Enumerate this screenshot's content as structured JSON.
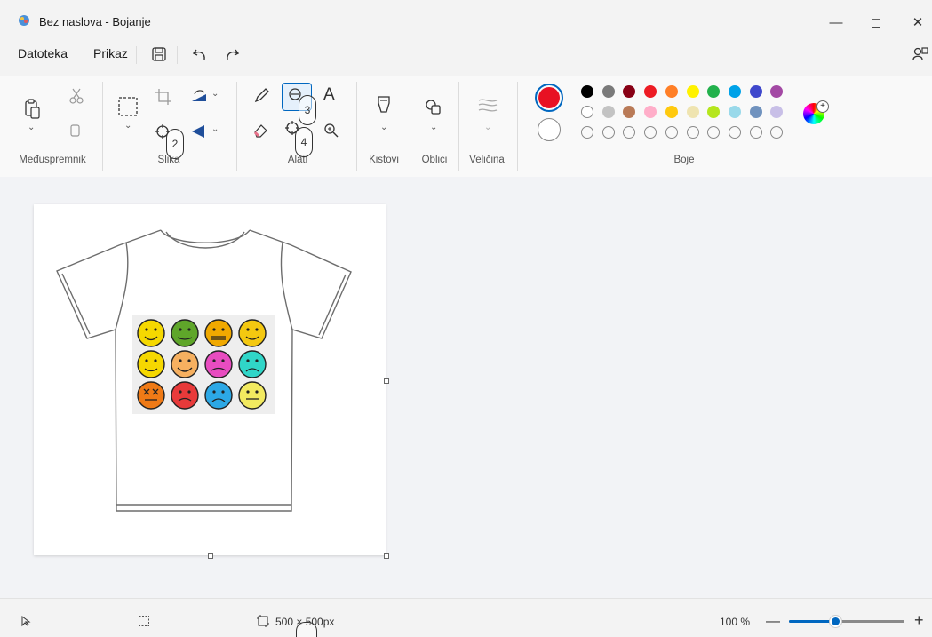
{
  "window": {
    "title": "Bez naslova - Bojanje"
  },
  "menu": {
    "file": "Datoteka",
    "view": "Prikaz"
  },
  "ribbon": {
    "groups": {
      "clipboard": "Međuspremnik",
      "image": "Slika",
      "tools": "Alati",
      "brushes": "Kistovi",
      "shapes": "Oblici",
      "size": "Veličina",
      "colors": "Boje"
    },
    "primary_color": "#e81123",
    "palette_row1": [
      "#000000",
      "#7a7a7a",
      "#880015",
      "#ed1c24",
      "#ff7f27",
      "#fff200",
      "#22b14c",
      "#00a2e8",
      "#3f48cc",
      "#a349a4"
    ],
    "palette_row2": [
      "#ffffff",
      "#c3c3c3",
      "#b97a57",
      "#ffaec9",
      "#ffc90e",
      "#efe4b0",
      "#b5e61d",
      "#99d9ea",
      "#7092be",
      "#c8bfe7"
    ],
    "palette_row3": [
      "",
      "",
      "",
      "",
      "",
      "",
      "",
      "",
      "",
      ""
    ]
  },
  "callouts": {
    "c2": "2",
    "c3": "3",
    "c4": "4"
  },
  "status": {
    "canvas_size": "500 × 500px",
    "zoom": "100 %",
    "zoom_fraction": 0.4
  },
  "icons": [
    "paste-icon",
    "cut-icon",
    "copy-icon",
    "select-icon",
    "crop-icon",
    "rotate-icon",
    "flip-icon",
    "pencil-icon",
    "fill-icon",
    "text-icon",
    "eraser-icon",
    "color-picker-icon",
    "magnifier-icon",
    "brush-icon",
    "shapes-icon",
    "size-icon",
    "edit-colors-icon"
  ]
}
